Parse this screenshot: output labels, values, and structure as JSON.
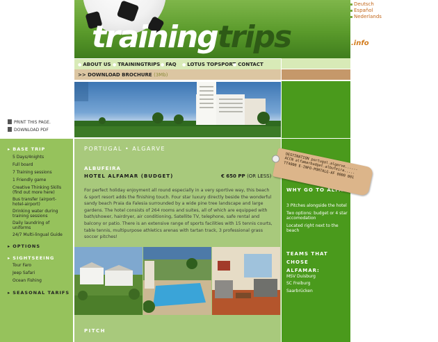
{
  "header": {
    "logo_main": "training",
    "logo_second": "trips",
    "logo_suffix": ".info"
  },
  "languages": [
    "Deutsch",
    "Español",
    "Nederlands"
  ],
  "nav": {
    "items": [
      "ABOUT US",
      "TRAININGTRIPS",
      "FAQ",
      "LOTUS TOPSPORT",
      "CONTACT"
    ]
  },
  "brochure": {
    "label": ">> DOWNLOAD BROCHURE",
    "size": "(3Mb)"
  },
  "tools": {
    "print": "PRINT THIS PAGE.",
    "pdf": "DOWNLOAD PDF"
  },
  "sidebar": {
    "base_trip": {
      "title": "BASE TRIP",
      "items": [
        "5 Days/4nights",
        "Full board",
        "7 Training sessions",
        "1 Friendly game",
        "Creative Thinking Skills (find out more here)",
        "Bus transfer (airport-hotel-airport)",
        "Drinking water during training sessions",
        "Daily laundring of uniforms",
        "24/7 Multi-lingual Guide"
      ]
    },
    "options_title": "OPTIONS",
    "sightseeing": {
      "title": "SIGHTSEEING",
      "items": [
        "Tour Faro",
        "Jeep Safari",
        "Ocean Fishing"
      ]
    },
    "seasonal_title": "SEASONAL TARIFS"
  },
  "main": {
    "region": "PORTUGAL • ALGARVE",
    "town": "ALBUFEIRA",
    "hotel": "HOTEL ALFAMAR (BUDGET)",
    "price": "€ 650 PP",
    "price_note": "(OR LESS)",
    "description": "For perfect holiday enjoyment all round especially in a very sportive way, this beach & sport resort adds the finishing touch. Four star luxury directly beside the wonderful sandy beach Praia da Falesia surrounded by a wide pine tree landscape and large gardens. The hotel consists of 264 rooms and suites, all of which are equipped with bath/shower, hairdryer, air conditioning, Satellite TV, telephone, safe rental and balcony or patio. There is an extensive range of sports facilities with 15 tennis courts, table tennis, multipurpose athletics arenas with tartan track, 3 professional grass soccer pitches!",
    "pitch_heading": "PITCH"
  },
  "tag": {
    "lines": [
      "DESTINATION portugal.algarve......",
      "ACCN alfamarbudget.albufeira.....",
      "TT4000 E-INFO-PORTALG-AF 0000 001"
    ]
  },
  "right": {
    "why_title": "WHY GO TO ALFAMAR?",
    "why_items": [
      "3 Pitches alongside the hotel",
      "Two options: budget or 4 star accomodation",
      "Located right next to the beach"
    ],
    "teams_title": "TEAMS THAT CHOSE ALFAMAR:",
    "teams": [
      "MSV Duisburg",
      "SC Freiburg",
      "Saarbrücken"
    ]
  },
  "colors": {
    "header_green": "#5a9a2b",
    "nav_bg": "#d8eab7",
    "brochure_bg": "#dcc6a2",
    "sidebar_green": "#96c25c",
    "main_bg": "#a8c97c",
    "right_green": "#4a9a1c",
    "lang_orange": "#c2671a"
  }
}
